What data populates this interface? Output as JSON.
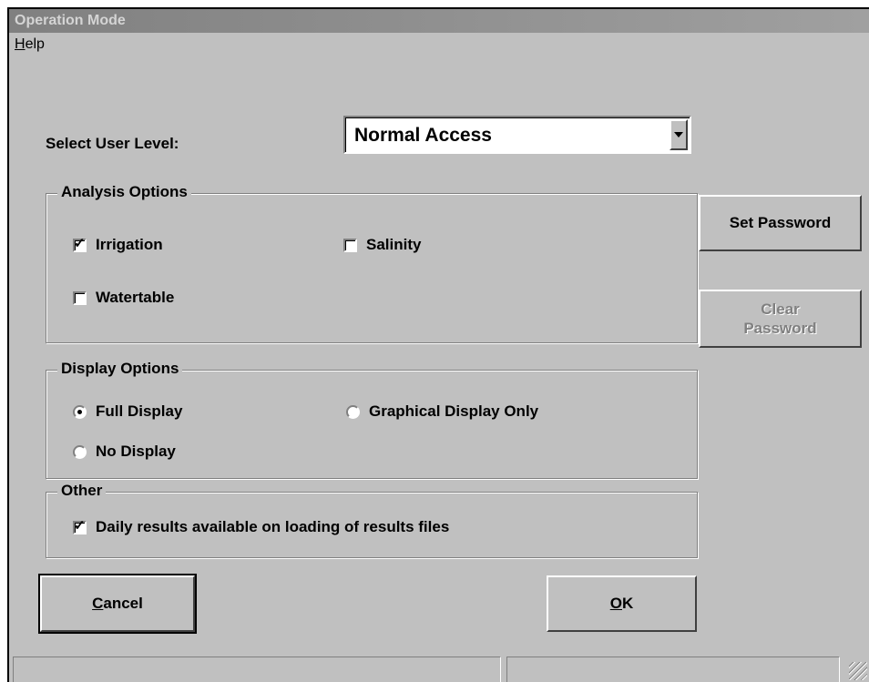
{
  "window": {
    "title": "Operation Mode"
  },
  "menu": {
    "help_underlined": "H",
    "help_rest": "elp"
  },
  "user_level": {
    "label": "Select User Level:",
    "selected": "Normal Access"
  },
  "analysis": {
    "legend": "Analysis Options",
    "options": [
      {
        "label": "Irrigation",
        "checked": true
      },
      {
        "label": "Salinity",
        "checked": false
      },
      {
        "label": "Watertable",
        "checked": false
      }
    ]
  },
  "display": {
    "legend": "Display Options",
    "options": [
      {
        "label": "Full Display",
        "selected": true
      },
      {
        "label": "Graphical Display Only",
        "selected": false
      },
      {
        "label": "No Display",
        "selected": false
      }
    ]
  },
  "other": {
    "legend": "Other",
    "daily_results": {
      "label": "Daily results available on loading of results files",
      "checked": true
    }
  },
  "buttons": {
    "set_password": "Set Password",
    "clear_password": "Clear Password",
    "cancel_underlined": "C",
    "cancel_rest": "ancel",
    "ok_underlined": "O",
    "ok_rest": "K"
  }
}
